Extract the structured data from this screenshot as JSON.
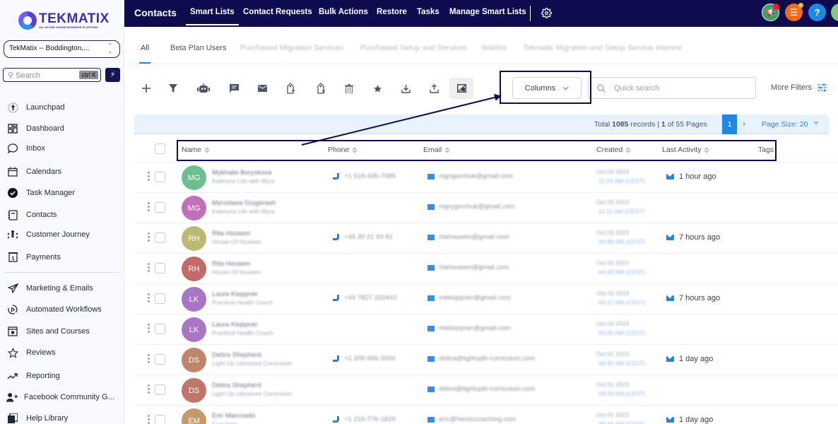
{
  "sidebar": {
    "logo": {
      "title": "TEKMATIX",
      "subtitle": "ALL IN ONE ONLINE BUSINESS PLATFORM"
    },
    "account": "TekMatix -- Boddington,...",
    "search": {
      "placeholder": "Search",
      "shortcut": "ctrl K"
    },
    "items": [
      {
        "label": "Launchpad",
        "icon": "rocket-icon"
      },
      {
        "label": "Dashboard",
        "icon": "dashboard-icon"
      },
      {
        "label": "Inbox",
        "icon": "chat-bubble-icon"
      },
      {
        "label": "Calendars",
        "icon": "calendar-icon"
      },
      {
        "label": "Task Manager",
        "icon": "check-circle-icon"
      },
      {
        "label": "Contacts",
        "icon": "address-book-icon"
      },
      {
        "label": "Customer Journey",
        "icon": "journey-icon"
      },
      {
        "label": "Payments",
        "icon": "invoice-icon"
      },
      {
        "label": "Marketing & Emails",
        "icon": "send-icon"
      },
      {
        "label": "Automated Workflows",
        "icon": "workflow-icon"
      },
      {
        "label": "Sites and Courses",
        "icon": "website-icon"
      },
      {
        "label": "Reviews",
        "icon": "star-icon"
      },
      {
        "label": "Reporting",
        "icon": "trend-icon"
      },
      {
        "label": "Facebook Community G...",
        "icon": "add-user-icon"
      },
      {
        "label": "Help Library",
        "icon": "book-icon"
      }
    ]
  },
  "topbar": {
    "title": "Contacts",
    "tabs": [
      "Smart Lists",
      "Contact Requests",
      "Bulk Actions",
      "Restore",
      "Tasks",
      "Manage Smart Lists"
    ],
    "active_tab": "Smart Lists",
    "help_label": "?"
  },
  "list_tabs": {
    "items": [
      "All",
      "Beta Plan Users",
      "Purchased Migration Services",
      "Purchased Setup and Services",
      "Waitlist",
      "Tekmatix Migration and Setup Service Interest"
    ],
    "active": "All"
  },
  "toolbar": {
    "icons": [
      "add-icon",
      "filter-icon",
      "robot-icon",
      "message-icon",
      "email-icon",
      "add-tag-icon",
      "remove-tag-icon",
      "trash-icon",
      "star-icon",
      "download-icon",
      "upload-icon",
      "merge-icon"
    ],
    "columns_label": "Columns",
    "quick_search_placeholder": "Quick search",
    "more_filters_label": "More Filters"
  },
  "pager": {
    "total_prefix": "Total ",
    "total": "1085",
    "total_mid": " records | ",
    "current": "1",
    "of_pages": " of 55 Pages",
    "page_button": "1",
    "page_size_label": "Page Size: 20"
  },
  "table": {
    "columns": [
      "Name",
      "Phone",
      "Email",
      "Created",
      "Last Activity",
      "Tags"
    ],
    "rows": [
      {
        "initials": "MG",
        "color": "#6dbf8e",
        "name": "Mykhailo Boryskova",
        "subtitle": "Kateryna Life with Myra",
        "phone": "+1 518-435-7089",
        "email": "mgrigorchuk@gmail.com",
        "created_date": "Oct 03 2023",
        "created_time": "11:24 AM (CEST)",
        "activity": "1 hour ago"
      },
      {
        "initials": "MG",
        "color": "#c06fb8",
        "name": "Myroslava Grygorash",
        "subtitle": "Kateryna Life with Myra",
        "phone": "",
        "email": "mgrygorchuk@gmail.com",
        "created_date": "Oct 03 2023",
        "created_time": "11:11 AM (CEST)",
        "activity": ""
      },
      {
        "initials": "RH",
        "color": "#b9bb72",
        "name": "Rita Houwen",
        "subtitle": "House Of Houwen",
        "phone": "+45 30 21 93 81",
        "email": "ritahouwen@gmail.com",
        "created_date": "Oct 03 2023",
        "created_time": "04:48 AM (CEST)",
        "activity": "7 hours ago"
      },
      {
        "initials": "RH",
        "color": "#c16a66",
        "name": "Rita Houwen",
        "subtitle": "House Of Houwen",
        "phone": "",
        "email": "ritahouwen@gmail.com",
        "created_date": "Oct 03 2023",
        "created_time": "04:33 AM (CEST)",
        "activity": ""
      },
      {
        "initials": "LK",
        "color": "#a876c4",
        "name": "Laura Kloppner",
        "subtitle": "Practical Health Coach",
        "phone": "+44 7827 332443",
        "email": "mkkloppner@gmail.com",
        "created_date": "Oct 03 2023",
        "created_time": "04:17 AM (CEST)",
        "activity": "7 hours ago"
      },
      {
        "initials": "LK",
        "color": "#a876c4",
        "name": "Laura Kloppner",
        "subtitle": "Practical Health Coach",
        "phone": "",
        "email": "mkkloppner@gmail.com",
        "created_date": "Oct 03 2023",
        "created_time": "04:05 AM (CEST)",
        "activity": ""
      },
      {
        "initials": "DS",
        "color": "#c0856a",
        "name": "Debra Shepherd",
        "subtitle": "Light Up Literature Curriculum",
        "phone": "+1 208-946-2000",
        "email": "debra@lightuplit-curriculum.com",
        "created_date": "Oct 01 2023",
        "created_time": "09:30 AM (CEST)",
        "activity": "1 day ago"
      },
      {
        "initials": "DS",
        "color": "#c0756a",
        "name": "Debra Shepherd",
        "subtitle": "Light Up Literature Curriculum",
        "phone": "",
        "email": "debra@lightuplit-curriculum.com",
        "created_date": "Oct 01 2023",
        "created_time": "09:26 AM (CEST)",
        "activity": ""
      },
      {
        "initials": "EM",
        "color": "#c49a6c",
        "name": "Eric Marcowitz",
        "subtitle": "Coaching",
        "phone": "+1 215-776-1829",
        "email": "eric@heroiccoaching.com",
        "created_date": "Oct 01 2023",
        "created_time": "08:44 AM (CEST)",
        "activity": "1 day ago"
      }
    ]
  },
  "colors": {
    "nav_bg": "#0e0b4f",
    "accent": "#1e88e5",
    "annotation": "#0e0b4f"
  }
}
